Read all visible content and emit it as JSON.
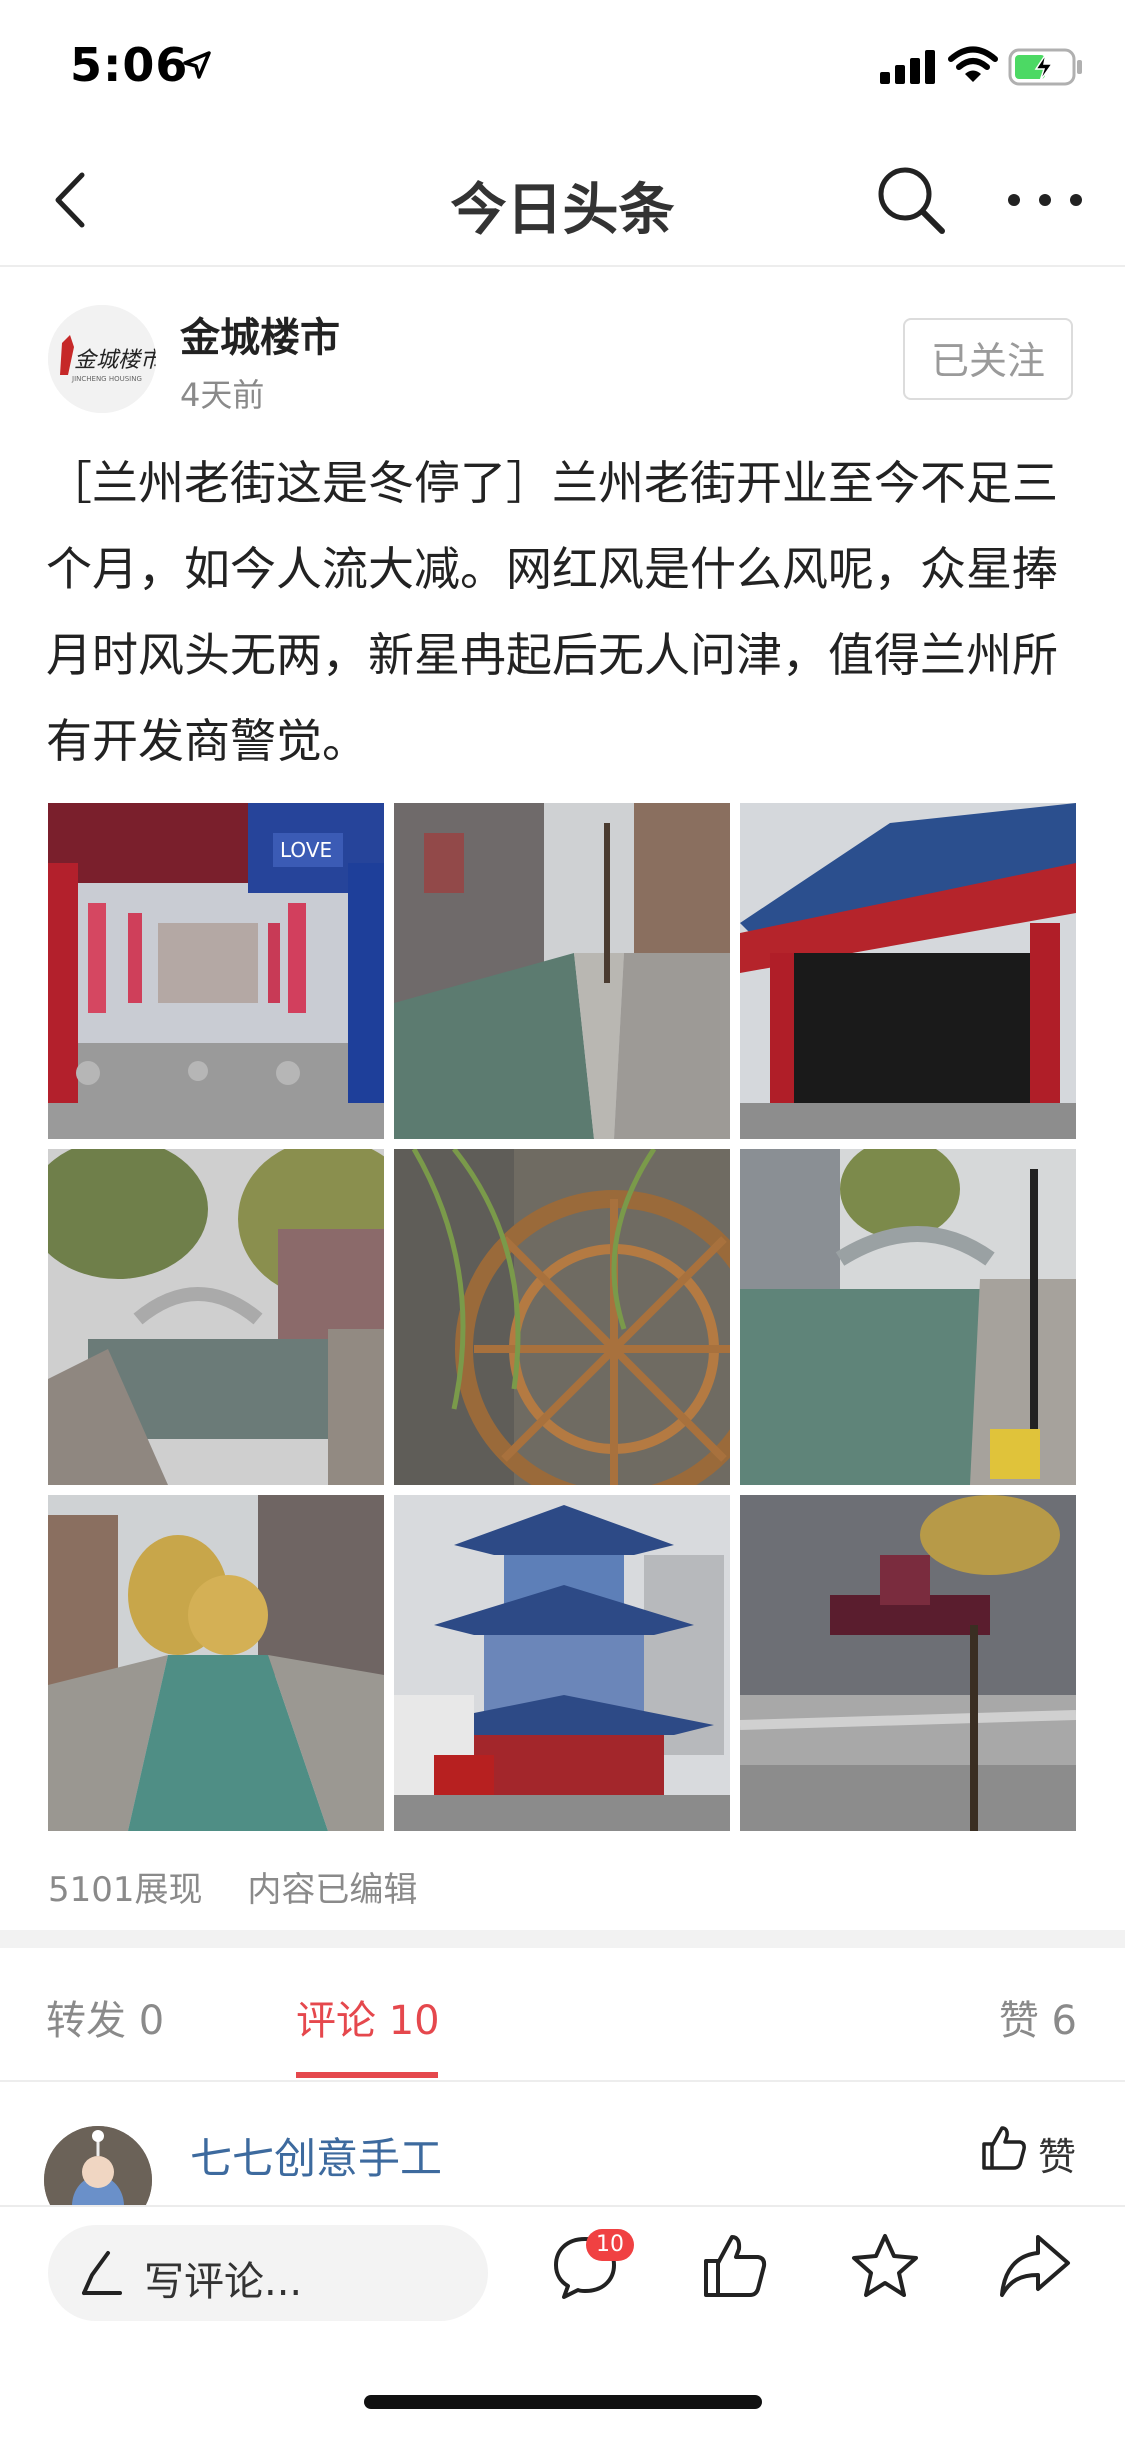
{
  "status_bar": {
    "time": "5:06"
  },
  "nav": {
    "title": "今日头条"
  },
  "author": {
    "name": "金城楼市",
    "time": "4天前",
    "follow_label": "已关注",
    "avatar_logo_text": "金城楼市"
  },
  "post": {
    "content": "［兰州老街这是冬停了］兰州老街开业至今不足三个月，如今人流大减。网红风是什么风呢，众星捧月时风头无两，新星冉起后无人问津，值得兰州所有开发商警觉。",
    "images": [
      {
        "label": "street-entrance-arch"
      },
      {
        "label": "canal-walkway"
      },
      {
        "label": "opera-stage"
      },
      {
        "label": "willow-bridge"
      },
      {
        "label": "water-wheel"
      },
      {
        "label": "canal-bridge"
      },
      {
        "label": "canal-view"
      },
      {
        "label": "pagoda-tower"
      },
      {
        "label": "grey-building"
      }
    ],
    "views": "5101展现",
    "edited": "内容已编辑"
  },
  "tabs": {
    "repost": "转发 0",
    "comment": "评论 10",
    "like": "赞 6"
  },
  "comment": {
    "user": "七七创意手工",
    "like_label": "赞"
  },
  "bottom_bar": {
    "write_placeholder": "写评论...",
    "comment_badge": "10"
  },
  "colors": {
    "accent": "#e5484d",
    "link": "#3d6a9e",
    "muted": "#8a8a8a"
  }
}
